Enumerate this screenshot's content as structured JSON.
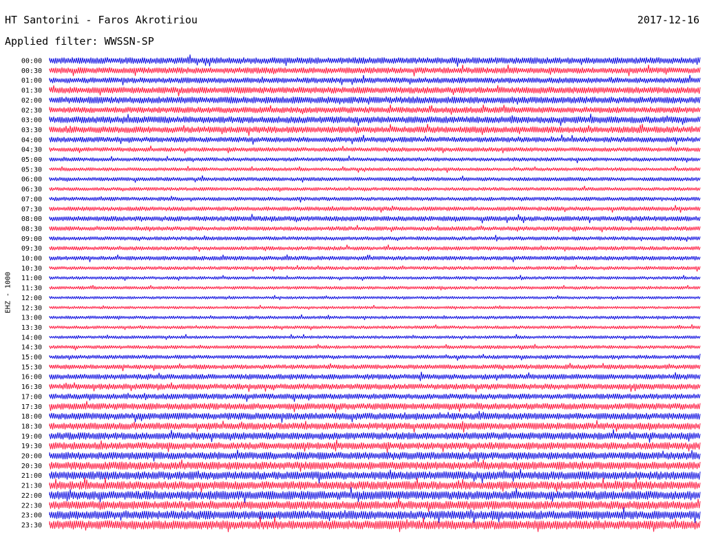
{
  "header": {
    "station": "HT Santorini - Faros Akrotiriou",
    "date": "2017-12-16",
    "filter": "Applied filter: WWSSN-SP",
    "channel": "EHZ - 1000"
  },
  "colors": {
    "trace_a": "#1010e0",
    "trace_b": "#ff1a40",
    "background": "#ffffff",
    "text": "#000000"
  },
  "chart_data": {
    "type": "line",
    "title": "HT Santorini - Faros Akrotiriou",
    "date": "2017-12-16",
    "filter": "WWSSN-SP",
    "ylabel": "EHZ - 1000",
    "xlabel": "",
    "series_colors": [
      "#1010e0",
      "#ff1a40"
    ],
    "categories": [
      "00:00",
      "00:30",
      "01:00",
      "01:30",
      "02:00",
      "02:30",
      "03:00",
      "03:30",
      "04:00",
      "04:30",
      "05:00",
      "05:30",
      "06:00",
      "06:30",
      "07:00",
      "07:30",
      "08:00",
      "08:30",
      "09:00",
      "09:30",
      "10:00",
      "10:30",
      "11:00",
      "11:30",
      "12:00",
      "12:30",
      "13:00",
      "13:30",
      "14:00",
      "14:30",
      "15:00",
      "15:30",
      "16:00",
      "16:30",
      "17:00",
      "17:30",
      "18:00",
      "18:30",
      "19:00",
      "19:30",
      "20:00",
      "20:30",
      "21:00",
      "21:30",
      "22:00",
      "22:30",
      "23:00",
      "23:30"
    ],
    "relative_amplitude": [
      0.9,
      0.85,
      0.8,
      0.9,
      0.95,
      0.85,
      0.95,
      0.9,
      0.75,
      0.6,
      0.55,
      0.5,
      0.55,
      0.5,
      0.55,
      0.6,
      0.7,
      0.6,
      0.55,
      0.55,
      0.6,
      0.5,
      0.45,
      0.45,
      0.4,
      0.4,
      0.45,
      0.45,
      0.45,
      0.5,
      0.55,
      0.65,
      0.75,
      0.8,
      0.8,
      0.9,
      0.95,
      0.95,
      1.0,
      1.0,
      1.05,
      1.1,
      1.15,
      1.15,
      1.2,
      1.15,
      1.2,
      1.25
    ]
  }
}
